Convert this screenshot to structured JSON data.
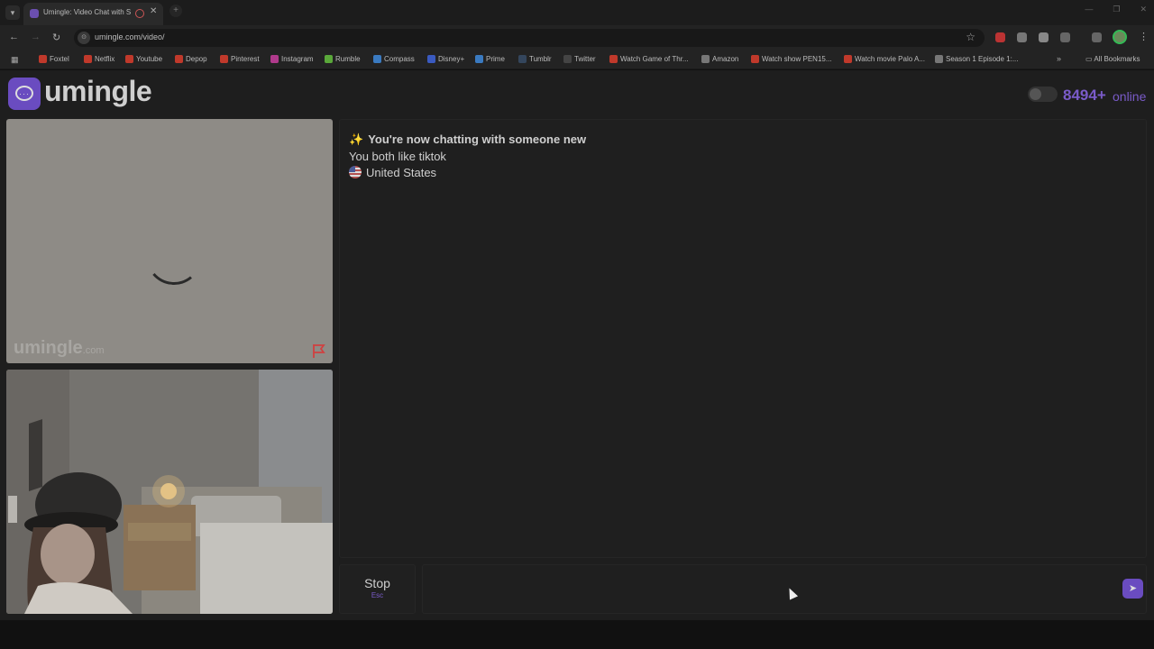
{
  "browser": {
    "tab_title": "Umingle: Video Chat with S",
    "url": "umingle.com/video/",
    "bookmarks": [
      {
        "label": "Foxtel",
        "color": "#c0392b"
      },
      {
        "label": "Netflix",
        "color": "#c0392b"
      },
      {
        "label": "Youtube",
        "color": "#c0392b"
      },
      {
        "label": "Depop",
        "color": "#c0392b"
      },
      {
        "label": "Pinterest",
        "color": "#c0392b"
      },
      {
        "label": "Instagram",
        "color": "#b03a8c"
      },
      {
        "label": "Rumble",
        "color": "#5aa83a"
      },
      {
        "label": "Compass",
        "color": "#3a7ac0"
      },
      {
        "label": "Disney+",
        "color": "#3a5ac0"
      },
      {
        "label": "Prime",
        "color": "#3a7ac0"
      },
      {
        "label": "Tumblr",
        "color": "#34465d"
      },
      {
        "label": "Twitter",
        "color": "#444444"
      },
      {
        "label": "Watch Game of Thr...",
        "color": "#c0392b"
      },
      {
        "label": "Amazon",
        "color": "#777777"
      },
      {
        "label": "Watch show PEN15...",
        "color": "#c0392b"
      },
      {
        "label": "Watch movie Palo A...",
        "color": "#c0392b"
      },
      {
        "label": "Season 1 Episode 1:...",
        "color": "#777777"
      }
    ],
    "all_bookmarks": "All Bookmarks"
  },
  "header": {
    "logo_text": "umingle",
    "online_count": "8494+",
    "online_label": "online",
    "brand_color": "#6a4cc0"
  },
  "stranger_video": {
    "watermark": "umingle",
    "watermark_suffix": ".com"
  },
  "chat": {
    "messages": [
      "You're now chatting with someone new",
      "You both like tiktok",
      "United States"
    ],
    "stop_label": "Stop",
    "stop_key": "Esc",
    "input_value": ""
  }
}
